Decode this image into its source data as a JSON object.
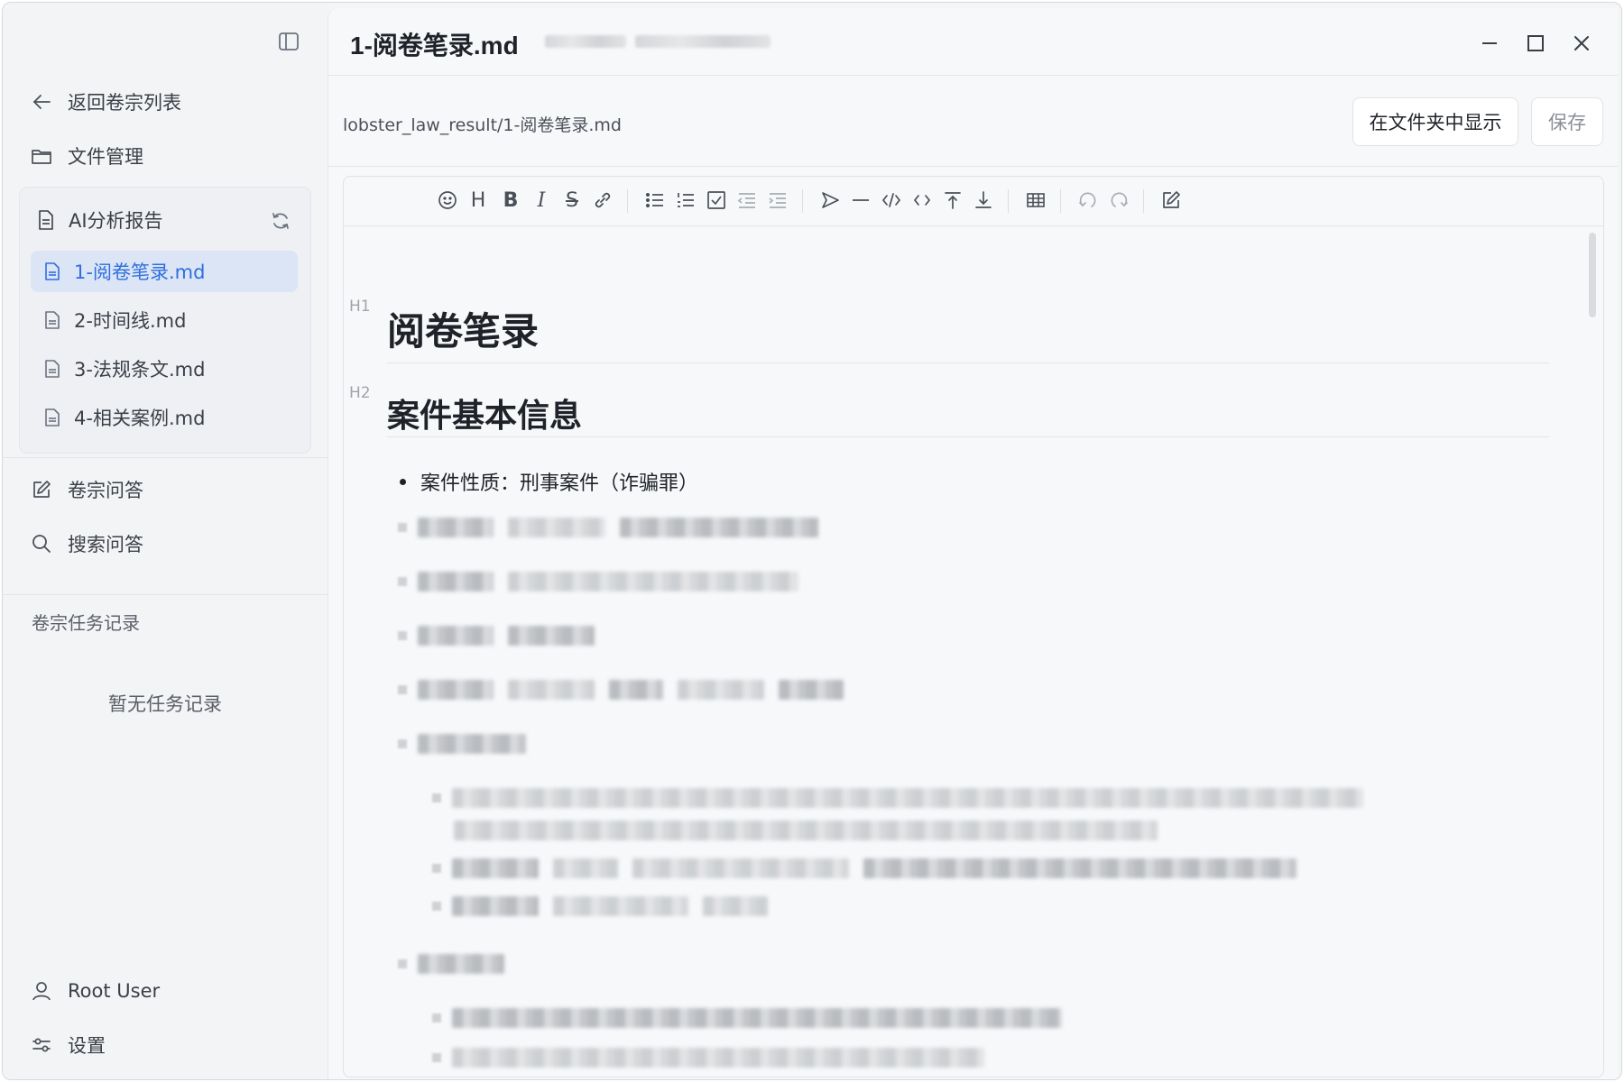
{
  "window": {
    "file_title": "1-阅卷笔录.md"
  },
  "sidebar": {
    "back_label": "返回卷宗列表",
    "files_label": "文件管理",
    "report": {
      "title": "AI分析报告",
      "files": [
        {
          "label": "1-阅卷笔录.md"
        },
        {
          "label": "2-时间线.md"
        },
        {
          "label": "3-法规条文.md"
        },
        {
          "label": "4-相关案例.md"
        }
      ]
    },
    "qa_label": "卷宗问答",
    "search_label": "搜索问答",
    "tasks_section_label": "卷宗任务记录",
    "tasks_empty": "暂无任务记录",
    "user_name": "Root User",
    "settings_label": "设置"
  },
  "pathbar": {
    "path": "lobster_law_result/1-阅卷笔录.md",
    "show_in_folder_label": "在文件夹中显示",
    "save_label": "保存"
  },
  "toolbar": {
    "icons": [
      "emoji-icon",
      "heading-icon",
      "bold-icon",
      "italic-icon",
      "strike-icon",
      "link-icon",
      "bullet-list-icon",
      "ordered-list-icon",
      "checklist-icon",
      "outdent-icon",
      "indent-icon",
      "quote-icon",
      "hr-icon",
      "code-block-icon",
      "inline-code-icon",
      "insert-before-icon",
      "insert-after-icon",
      "table-icon",
      "undo-icon",
      "redo-icon",
      "edit-mode-icon"
    ],
    "heading_glyph": "H",
    "bold_glyph": "B",
    "italic_glyph": "I",
    "strike_glyph": "S"
  },
  "document": {
    "h1_tag": "H1",
    "h1": "阅卷笔录",
    "h2_tag": "H2",
    "h2": "案件基本信息",
    "first_bullet": "案件性质：刑事案件（诈骗罪）"
  },
  "colors": {
    "accent": "#2f6fde",
    "active_bg": "#dbe5f6"
  }
}
